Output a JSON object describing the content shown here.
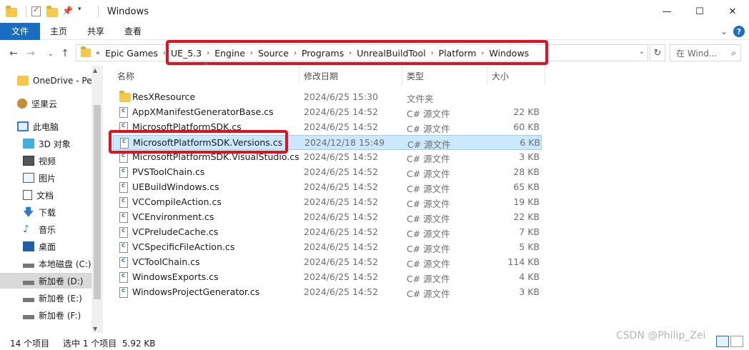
{
  "window": {
    "title": "Windows",
    "minimize": "—",
    "maximize": "☐",
    "close": "✕"
  },
  "ribbon": {
    "tabs": [
      "文件",
      "主页",
      "共享",
      "查看"
    ],
    "expand": "⌄",
    "help": "?"
  },
  "nav": {
    "back": "←",
    "forward": "→",
    "recent": "⌄",
    "up": "↑",
    "refresh": "↻"
  },
  "address": {
    "overflow": "«",
    "crumbs": [
      "Epic Games",
      "UE_5.3",
      "Engine",
      "Source",
      "Programs",
      "UnrealBuildTool",
      "Platform",
      "Windows"
    ],
    "sep": "›",
    "dropdown": "⌄"
  },
  "search": {
    "placeholder": "在 Wind...",
    "icon": "⌕"
  },
  "sidebar": {
    "items": [
      {
        "label": "OneDrive - Pe",
        "icon": "folder-icon"
      },
      {
        "label": "坚果云",
        "icon": "nut-icon"
      },
      {
        "label": "此电脑",
        "icon": "computer-icon"
      },
      {
        "label": "3D 对象",
        "icon": "cube-icon"
      },
      {
        "label": "视频",
        "icon": "video-icon"
      },
      {
        "label": "图片",
        "icon": "picture-icon"
      },
      {
        "label": "文档",
        "icon": "document-icon"
      },
      {
        "label": "下载",
        "icon": "download-icon"
      },
      {
        "label": "音乐",
        "icon": "music-icon"
      },
      {
        "label": "桌面",
        "icon": "desktop-icon"
      },
      {
        "label": "本地磁盘 (C:)",
        "icon": "drive-icon"
      },
      {
        "label": "新加卷 (D:)",
        "icon": "drive-icon"
      },
      {
        "label": "新加卷 (E:)",
        "icon": "drive-icon"
      },
      {
        "label": "新加卷 (F:)",
        "icon": "drive-icon"
      }
    ],
    "selected_index": 11
  },
  "columns": {
    "name": "名称",
    "date": "修改日期",
    "type": "类型",
    "size": "大小"
  },
  "files": [
    {
      "name": "ResXResource",
      "date": "2024/6/25 15:30",
      "type": "文件夹",
      "size": "",
      "kind": "folder"
    },
    {
      "name": "AppXManifestGeneratorBase.cs",
      "date": "2024/6/25 14:52",
      "type": "C# 源文件",
      "size": "22 KB",
      "kind": "file"
    },
    {
      "name": "MicrosoftPlatformSDK.cs",
      "date": "2024/6/25 14:52",
      "type": "C# 源文件",
      "size": "60 KB",
      "kind": "file"
    },
    {
      "name": "MicrosoftPlatformSDK.Versions.cs",
      "date": "2024/12/18 15:49",
      "type": "C# 源文件",
      "size": "6 KB",
      "kind": "file",
      "selected": true
    },
    {
      "name": "MicrosoftPlatformSDK.VisualStudio.cs",
      "date": "2024/6/25 14:52",
      "type": "C# 源文件",
      "size": "3 KB",
      "kind": "file"
    },
    {
      "name": "PVSToolChain.cs",
      "date": "2024/6/25 14:52",
      "type": "C# 源文件",
      "size": "28 KB",
      "kind": "file"
    },
    {
      "name": "UEBuildWindows.cs",
      "date": "2024/6/25 14:52",
      "type": "C# 源文件",
      "size": "65 KB",
      "kind": "file"
    },
    {
      "name": "VCCompileAction.cs",
      "date": "2024/6/25 14:52",
      "type": "C# 源文件",
      "size": "19 KB",
      "kind": "file"
    },
    {
      "name": "VCEnvironment.cs",
      "date": "2024/6/25 14:52",
      "type": "C# 源文件",
      "size": "22 KB",
      "kind": "file"
    },
    {
      "name": "VCPreludeCache.cs",
      "date": "2024/6/25 14:52",
      "type": "C# 源文件",
      "size": "7 KB",
      "kind": "file"
    },
    {
      "name": "VCSpecificFileAction.cs",
      "date": "2024/6/25 14:52",
      "type": "C# 源文件",
      "size": "5 KB",
      "kind": "file"
    },
    {
      "name": "VCToolChain.cs",
      "date": "2024/6/25 14:52",
      "type": "C# 源文件",
      "size": "114 KB",
      "kind": "file"
    },
    {
      "name": "WindowsExports.cs",
      "date": "2024/6/25 14:52",
      "type": "C# 源文件",
      "size": "4 KB",
      "kind": "file"
    },
    {
      "name": "WindowsProjectGenerator.cs",
      "date": "2024/6/25 14:52",
      "type": "C# 源文件",
      "size": "3 KB",
      "kind": "file"
    }
  ],
  "status": {
    "count": "14 个项目",
    "selection": "选中 1 个项目  5.92 KB"
  },
  "watermark": "CSDN @Philip_Zei",
  "colors": {
    "accent": "#1a6ec1",
    "highlight_box": "#e3101f",
    "selection": "#cce8ff"
  }
}
